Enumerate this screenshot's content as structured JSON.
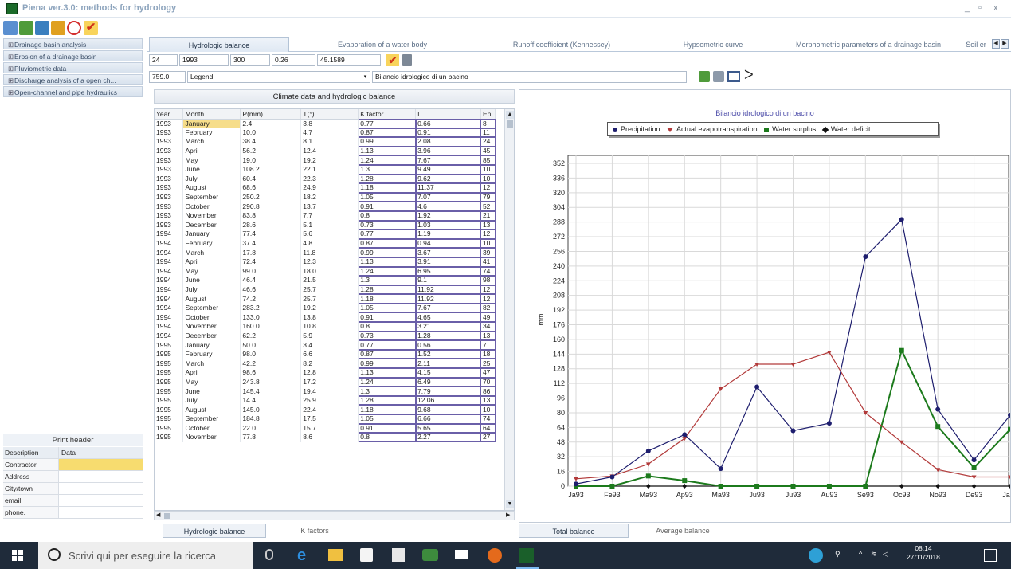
{
  "window": {
    "title": "Piena ver.3.0: methods for hydrology",
    "controls": [
      "_",
      "▫",
      "x"
    ]
  },
  "left_tree": [
    "Drainage basin analysis",
    "Erosion of a drainage basin",
    "Pluviometric data",
    "Discharge analysis of a open ch...",
    "Open-channel and pipe hydraulics"
  ],
  "print_header": {
    "title": "Print header",
    "col_description": "Description",
    "col_data": "Data",
    "rows": [
      "Contractor",
      "Address",
      "City/town",
      "email",
      "phone."
    ]
  },
  "tabs": [
    {
      "label": "Hydrologic balance"
    },
    {
      "label": "Evaporation of a water body"
    },
    {
      "label": "Runoff coefficient (Kennessey)"
    },
    {
      "label": "Hypsometric curve"
    },
    {
      "label": "Morphometric parameters of a drainage basin"
    },
    {
      "label": "Soil er"
    }
  ],
  "params": {
    "stations": "24",
    "year": "1993",
    "val1": "300",
    "val2": "0.26",
    "val3": "45.1589",
    "val4": "759.0",
    "legend": "Legend",
    "chart_title": "Bilancio idrologico di un bacino"
  },
  "table": {
    "title": "Climate data and hydrologic balance",
    "headers": [
      "Year",
      "Month",
      "P(mm)",
      "T(°)",
      "K factor",
      "I",
      "Ep"
    ],
    "rows": [
      [
        "1993",
        "January",
        "2.4",
        "3.8",
        "0.77",
        "0.66",
        "8"
      ],
      [
        "1993",
        "February",
        "10.0",
        "4.7",
        "0.87",
        "0.91",
        "11"
      ],
      [
        "1993",
        "March",
        "38.4",
        "8.1",
        "0.99",
        "2.08",
        "24"
      ],
      [
        "1993",
        "April",
        "56.2",
        "12.4",
        "1.13",
        "3.96",
        "45"
      ],
      [
        "1993",
        "May",
        "19.0",
        "19.2",
        "1.24",
        "7.67",
        "85"
      ],
      [
        "1993",
        "June",
        "108.2",
        "22.1",
        "1.3",
        "9.49",
        "10"
      ],
      [
        "1993",
        "July",
        "60.4",
        "22.3",
        "1.28",
        "9.62",
        "10"
      ],
      [
        "1993",
        "August",
        "68.6",
        "24.9",
        "1.18",
        "11.37",
        "12"
      ],
      [
        "1993",
        "September",
        "250.2",
        "18.2",
        "1.05",
        "7.07",
        "79"
      ],
      [
        "1993",
        "October",
        "290.8",
        "13.7",
        "0.91",
        "4.6",
        "52"
      ],
      [
        "1993",
        "November",
        "83.8",
        "7.7",
        "0.8",
        "1.92",
        "21"
      ],
      [
        "1993",
        "December",
        "28.6",
        "5.1",
        "0.73",
        "1.03",
        "13"
      ],
      [
        "1994",
        "January",
        "77.4",
        "5.6",
        "0.77",
        "1.19",
        "12"
      ],
      [
        "1994",
        "February",
        "37.4",
        "4.8",
        "0.87",
        "0.94",
        "10"
      ],
      [
        "1994",
        "March",
        "17.8",
        "11.8",
        "0.99",
        "3.67",
        "39"
      ],
      [
        "1994",
        "April",
        "72.4",
        "12.3",
        "1.13",
        "3.91",
        "41"
      ],
      [
        "1994",
        "May",
        "99.0",
        "18.0",
        "1.24",
        "6.95",
        "74"
      ],
      [
        "1994",
        "June",
        "46.4",
        "21.5",
        "1.3",
        "9.1",
        "98"
      ],
      [
        "1994",
        "July",
        "46.6",
        "25.7",
        "1.28",
        "11.92",
        "12"
      ],
      [
        "1994",
        "August",
        "74.2",
        "25.7",
        "1.18",
        "11.92",
        "12"
      ],
      [
        "1994",
        "September",
        "283.2",
        "19.2",
        "1.05",
        "7.67",
        "82"
      ],
      [
        "1994",
        "October",
        "133.0",
        "13.8",
        "0.91",
        "4.65",
        "49"
      ],
      [
        "1994",
        "November",
        "160.0",
        "10.8",
        "0.8",
        "3.21",
        "34"
      ],
      [
        "1994",
        "December",
        "62.2",
        "5.9",
        "0.73",
        "1.28",
        "13"
      ],
      [
        "1995",
        "January",
        "50.0",
        "3.4",
        "0.77",
        "0.56",
        "7"
      ],
      [
        "1995",
        "February",
        "98.0",
        "6.6",
        "0.87",
        "1.52",
        "18"
      ],
      [
        "1995",
        "March",
        "42.2",
        "8.2",
        "0.99",
        "2.11",
        "25"
      ],
      [
        "1995",
        "April",
        "98.6",
        "12.8",
        "1.13",
        "4.15",
        "47"
      ],
      [
        "1995",
        "May",
        "243.8",
        "17.2",
        "1.24",
        "6.49",
        "70"
      ],
      [
        "1995",
        "June",
        "145.4",
        "19.4",
        "1.3",
        "7.79",
        "86"
      ],
      [
        "1995",
        "July",
        "14.4",
        "25.9",
        "1.28",
        "12.06",
        "13"
      ],
      [
        "1995",
        "August",
        "145.0",
        "22.4",
        "1.18",
        "9.68",
        "10"
      ],
      [
        "1995",
        "September",
        "184.8",
        "17.5",
        "1.05",
        "6.66",
        "74"
      ],
      [
        "1995",
        "October",
        "22.0",
        "15.7",
        "0.91",
        "5.65",
        "64"
      ],
      [
        "1995",
        "November",
        "77.8",
        "8.6",
        "0.8",
        "2.27",
        "27"
      ]
    ]
  },
  "bottom_tabs_left": [
    "Hydrologic balance",
    "K factors"
  ],
  "bottom_tabs_right": [
    "Total balance",
    "Average balance"
  ],
  "chart_data": {
    "type": "line",
    "title": "Bilancio idrologico di un bacino",
    "ylabel": "mm",
    "ylim": [
      0,
      352
    ],
    "yticks": [
      0,
      16,
      32,
      48,
      64,
      80,
      96,
      112,
      128,
      144,
      160,
      176,
      192,
      208,
      224,
      240,
      256,
      272,
      288,
      304,
      320,
      336,
      352
    ],
    "categories": [
      "Ja93",
      "Fe93",
      "Ma93",
      "Ap93",
      "Ma93",
      "Ju93",
      "Ju93",
      "Au93",
      "Se93",
      "Oc93",
      "No93",
      "De93",
      "Ja94"
    ],
    "series": [
      {
        "name": "Precipitation",
        "color": "#1e1e6e",
        "marker": "circle",
        "values": [
          2.4,
          10.0,
          38.4,
          56.2,
          19.0,
          108.2,
          60.4,
          68.6,
          250.2,
          290.8,
          83.8,
          28.6,
          77.4
        ]
      },
      {
        "name": "Actual evapotranspiration",
        "color": "#b23a3a",
        "marker": "triangle",
        "values": [
          8,
          11,
          24,
          52,
          106,
          133,
          133,
          146,
          80,
          48,
          18,
          10,
          10
        ]
      },
      {
        "name": "Water surplus",
        "color": "#1c7a1c",
        "marker": "square",
        "values": [
          0,
          0,
          11,
          6,
          0,
          0,
          0,
          0,
          0,
          148,
          65,
          20,
          62
        ]
      },
      {
        "name": "Water deficit",
        "color": "#111111",
        "marker": "diamond",
        "values": [
          0,
          0,
          0,
          0,
          0,
          0,
          0,
          0,
          0,
          0,
          0,
          0,
          0
        ]
      }
    ],
    "legend_position": "top",
    "grid": true
  },
  "taskbar": {
    "search_placeholder": "Scrivi qui per eseguire la ricerca",
    "time": "08:14",
    "date": "27/11/2018"
  }
}
